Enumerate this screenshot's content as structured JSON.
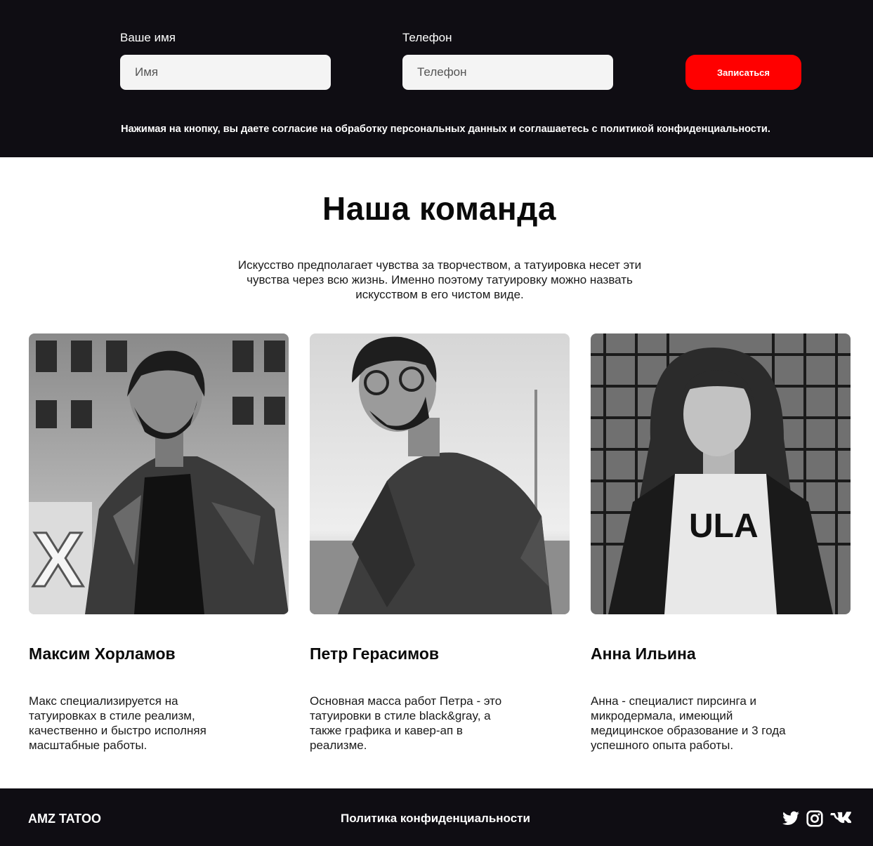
{
  "form": {
    "name_label": "Ваше имя",
    "name_placeholder": "Имя",
    "phone_label": "Телефон",
    "phone_placeholder": "Телефон",
    "submit_label": "Записаться",
    "consent_text": "Нажимая на кнопку, вы даете согласие на обработку персональных данных и соглашаетесь с политикой конфиденциальности."
  },
  "team": {
    "title": "Наша команда",
    "lead": "Искусство предполагает чувства за творчеством, а татуировка несет эти чувства через всю жизнь. Именно поэтому татуировку можно назвать искусством в его чистом виде.",
    "members": [
      {
        "name": "Максим Хорламов",
        "description": "Макс специализируется на татуировках в стиле реализм, качественно и быстро исполняя масштабные работы."
      },
      {
        "name": "Петр Герасимов",
        "description": "Основная масса работ Петра - это татуировки в стиле black&gray, а также графика и кавер-ап в реализме."
      },
      {
        "name": "Анна Ильина",
        "description": "Анна - специалист пирсинга и микродермала, имеющий медицинское образование и 3 года успешного опыта работы."
      }
    ]
  },
  "footer": {
    "brand": "AMZ TATOO",
    "policy_link": "Политика конфиденциальности",
    "social_icons": [
      "twitter-icon",
      "instagram-icon",
      "vk-icon"
    ]
  },
  "colors": {
    "dark_band": "#0f0d13",
    "accent_button": "#ff0000",
    "input_bg": "#f4f4f4"
  }
}
